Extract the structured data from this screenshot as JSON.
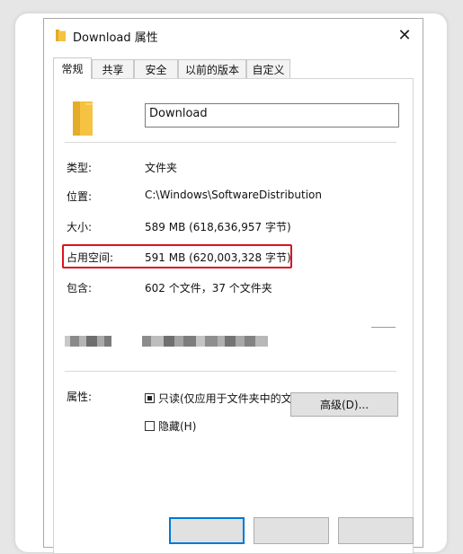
{
  "window": {
    "title": "Download 属性",
    "close_glyph": "✕"
  },
  "tabs": [
    {
      "label": "常规",
      "active": true
    },
    {
      "label": "共享",
      "active": false
    },
    {
      "label": "安全",
      "active": false
    },
    {
      "label": "以前的版本",
      "active": false
    },
    {
      "label": "自定义",
      "active": false
    }
  ],
  "general": {
    "name_value": "Download",
    "rows": [
      {
        "label": "类型:",
        "value": "文件夹"
      },
      {
        "label": "位置:",
        "value": "C:\\Windows\\SoftwareDistribution"
      },
      {
        "label": "大小:",
        "value": "589 MB (618,636,957 字节)"
      },
      {
        "label": "占用空间:",
        "value": "591 MB (620,003,328 字节)"
      },
      {
        "label": "包含:",
        "value": "602 个文件，37 个文件夹"
      }
    ],
    "attributes_label": "属性:",
    "readonly_label": "只读(仅应用于文件夹中的文件)(R)",
    "readonly_state": "indeterminate",
    "hidden_label": "隐藏(H)",
    "hidden_checked": false,
    "advanced_button": "高级(D)..."
  },
  "colors": {
    "folder_yellow": "#f5c242",
    "folder_dark": "#d9a520",
    "highlight_red": "#d9141f",
    "accent_blue": "#0078d7"
  },
  "icons": {
    "title": "folder-icon",
    "large": "folder-icon",
    "close": "close-icon"
  }
}
